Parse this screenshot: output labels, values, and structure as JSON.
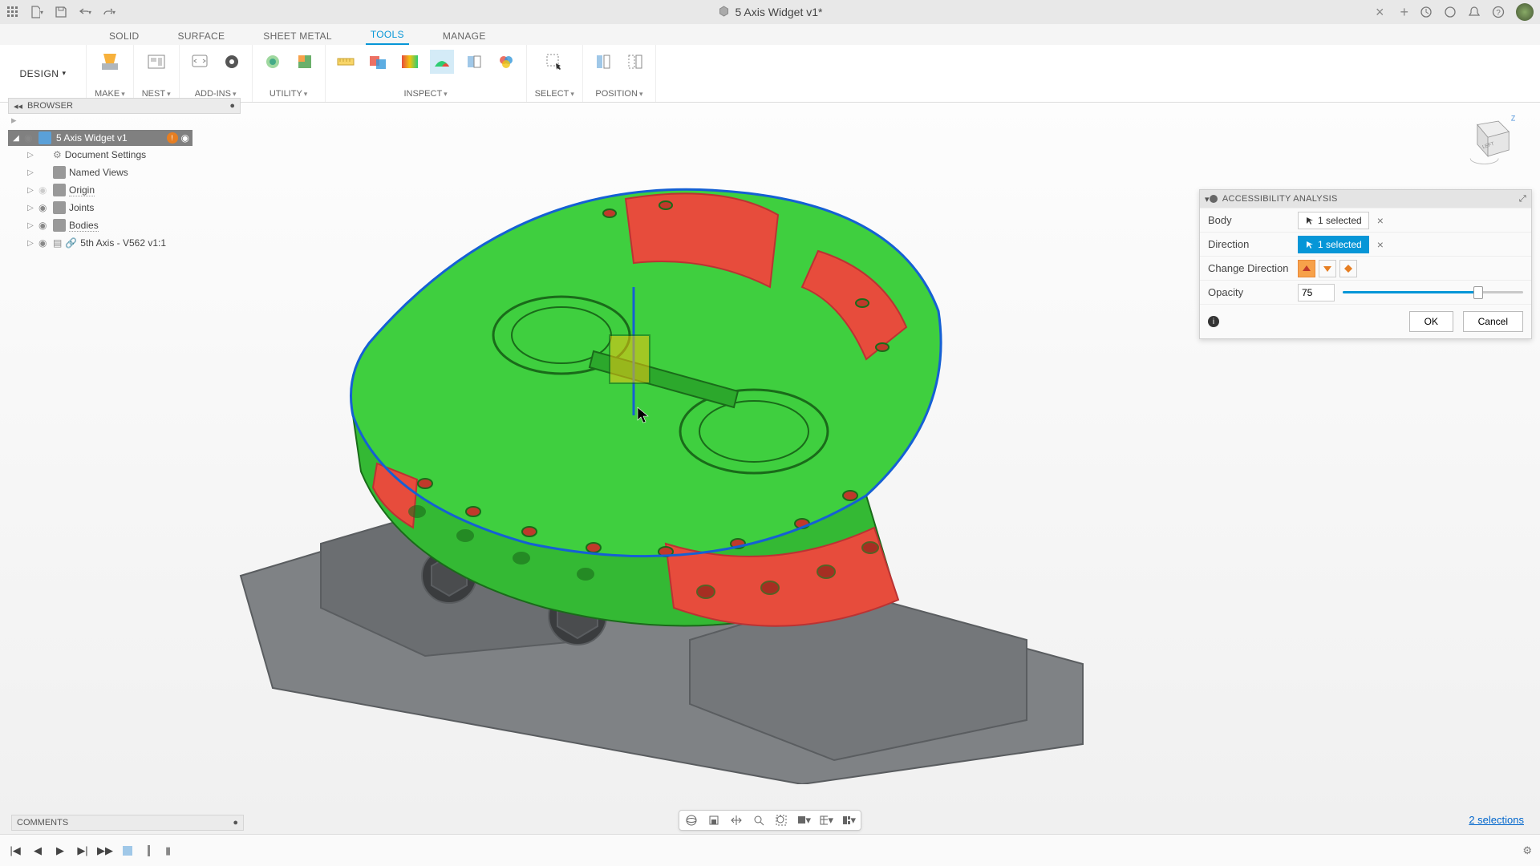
{
  "titlebar": {
    "doc_title": "5 Axis Widget v1*"
  },
  "design_switcher": "DESIGN",
  "ribbon_tabs": [
    "SOLID",
    "SURFACE",
    "SHEET METAL",
    "TOOLS",
    "MANAGE"
  ],
  "ribbon_active_tab": "TOOLS",
  "ribbon_groups": {
    "make": "MAKE",
    "nest": "NEST",
    "addins": "ADD-INS",
    "utility": "UTILITY",
    "inspect": "INSPECT",
    "select": "SELECT",
    "position": "POSITION"
  },
  "browser": {
    "title": "BROWSER",
    "root": "5 Axis Widget v1",
    "items": [
      {
        "label": "Document Settings"
      },
      {
        "label": "Named Views"
      },
      {
        "label": "Origin",
        "dotted": true
      },
      {
        "label": "Joints"
      },
      {
        "label": "Bodies",
        "dotted": true
      },
      {
        "label": "5th Axis - V562 v1:1"
      }
    ]
  },
  "panel": {
    "title": "ACCESSIBILITY ANALYSIS",
    "rows": {
      "body_label": "Body",
      "body_value": "1 selected",
      "direction_label": "Direction",
      "direction_value": "1 selected",
      "change_dir_label": "Change Direction",
      "opacity_label": "Opacity",
      "opacity_value": "75"
    },
    "ok": "OK",
    "cancel": "Cancel"
  },
  "comments": {
    "title": "COMMENTS"
  },
  "selections_text": "2 selections",
  "viewcube": {
    "z": "Z"
  }
}
